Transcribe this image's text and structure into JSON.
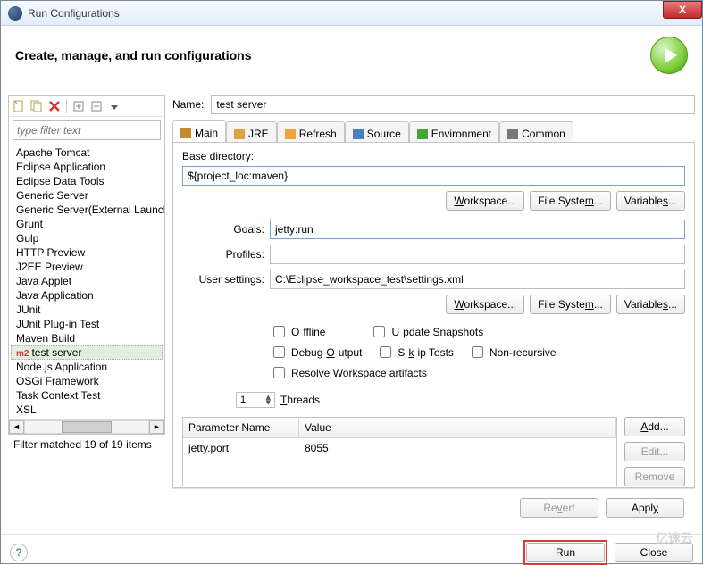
{
  "window": {
    "title": "Run Configurations",
    "close": "X"
  },
  "header": {
    "title": "Create, manage, and run configurations"
  },
  "filter": {
    "placeholder": "type filter text",
    "status": "Filter matched 19 of 19 items"
  },
  "tree": {
    "items": [
      "Apache Tomcat",
      "Eclipse Application",
      "Eclipse Data Tools",
      "Generic Server",
      "Generic Server(External Launch)",
      "Grunt",
      "Gulp",
      "HTTP Preview",
      "J2EE Preview",
      "Java Applet",
      "Java Application",
      "JUnit",
      "JUnit Plug-in Test",
      "Maven Build",
      "test server",
      "Node.js Application",
      "OSGi Framework",
      "Task Context Test",
      "XSL"
    ],
    "selected_index": 14,
    "selected_prefix": "m2"
  },
  "name": {
    "label": "Name:",
    "value": "test server"
  },
  "tabs": {
    "items": [
      "Main",
      "JRE",
      "Refresh",
      "Source",
      "Environment",
      "Common"
    ],
    "active_index": 0
  },
  "main_tab": {
    "base_label": "Base directory:",
    "base_value": "${project_loc:maven}",
    "goals_label": "Goals:",
    "goals_value": "jetty:run",
    "profiles_label": "Profiles:",
    "profiles_value": "",
    "user_label": "User settings:",
    "user_value": "C:\\Eclipse_workspace_test\\settings.xml",
    "btn_workspace": "Workspace...",
    "btn_filesystem": "File System...",
    "btn_variables": "Variables...",
    "checks": {
      "offline": "Offline",
      "update": "Update Snapshots",
      "debug": "Debug Output",
      "skip": "Skip Tests",
      "nonrec": "Non-recursive",
      "resolve": "Resolve Workspace artifacts"
    },
    "threads_value": "1",
    "threads_label": "Threads",
    "param_name_header": "Parameter Name",
    "param_value_header": "Value",
    "params": [
      {
        "name": "jetty.port",
        "value": "8055"
      }
    ],
    "btn_add": "Add...",
    "btn_edit": "Edit...",
    "btn_remove": "Remove"
  },
  "buttons": {
    "revert": "Revert",
    "apply": "Apply",
    "run": "Run",
    "close": "Close"
  },
  "watermark": "亿速云"
}
